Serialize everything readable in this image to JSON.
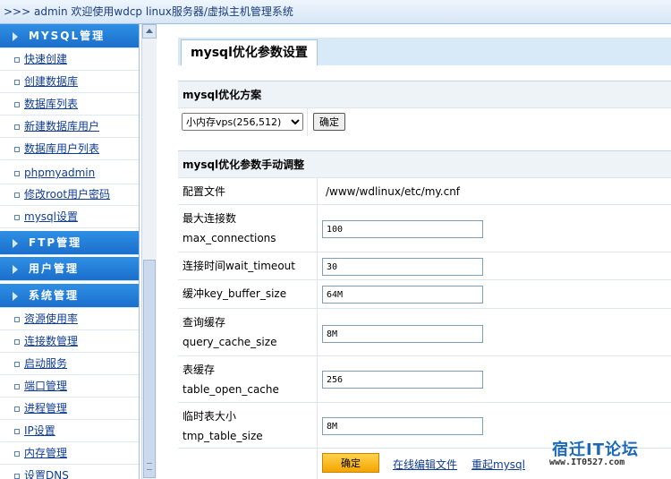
{
  "topbar": {
    "text": ">>> admin 欢迎使用wdcp linux服务器/虚拟主机管理系统"
  },
  "sidebar": {
    "mysql_header": "MYSQL管理",
    "mysql_items": [
      "快速创建",
      "创建数据库",
      "数据库列表",
      "新建数据库用户",
      "数据库用户列表",
      "phpmyadmin",
      "修改root用户密码",
      "mysql设置"
    ],
    "ftp_header": "FTP管理",
    "user_header": "用户管理",
    "system_header": "系统管理",
    "system_items": [
      "资源使用率",
      "连接数管理",
      "启动服务",
      "端口管理",
      "进程管理",
      "IP设置",
      "内存管理",
      "设置DNS"
    ]
  },
  "main": {
    "tab_title": "mysql优化参数设置",
    "scheme": {
      "title": "mysql优化方案",
      "selected": "小内存vps(256,512)",
      "confirm": "确定"
    },
    "manual": {
      "title": "mysql优化参数手动调整",
      "config_file_label": "配置文件",
      "config_file_value": "/www/wdlinux/etc/my.cnf",
      "max_conn_label1": "最大连接数",
      "max_conn_label2": "max_connections",
      "max_conn_value": "100",
      "wait_label": "连接时间wait_timeout",
      "wait_value": "30",
      "key_buffer_label": "缓冲key_buffer_size",
      "key_buffer_value": "64M",
      "query_cache_label1": "查询缓存",
      "query_cache_label2": "query_cache_size",
      "query_cache_value": "8M",
      "table_cache_label1": "表缓存",
      "table_cache_label2": "table_open_cache",
      "table_cache_value": "256",
      "tmp_table_label1": "临时表大小",
      "tmp_table_label2": "tmp_table_size",
      "tmp_table_value": "8M",
      "submit": "确定",
      "online_edit": "在线编辑文件",
      "restart": "重起mysql"
    }
  },
  "watermark": {
    "title": "宿迁IT论坛",
    "url": "www.IT0527.com"
  }
}
